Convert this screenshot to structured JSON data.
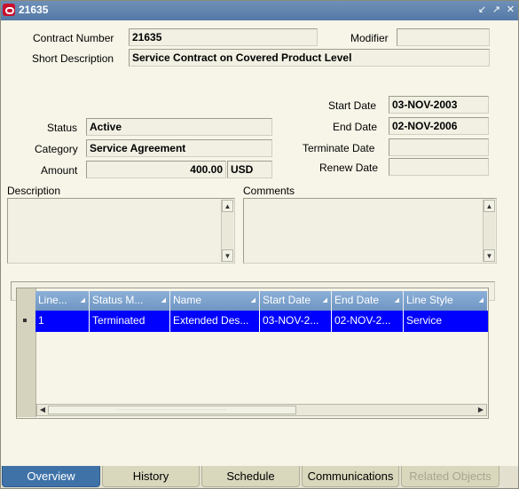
{
  "window": {
    "title": "21635"
  },
  "header": {
    "contract_number_label": "Contract Number",
    "contract_number": "21635",
    "modifier_label": "Modifier",
    "modifier": "",
    "short_description_label": "Short Description",
    "short_description": "Service Contract on Covered Product Level",
    "status_label": "Status",
    "status": "Active",
    "category_label": "Category",
    "category": "Service Agreement",
    "amount_label": "Amount",
    "amount": "400.00",
    "currency": "USD",
    "start_date_label": "Start Date",
    "start_date": "03-NOV-2003",
    "end_date_label": "End Date",
    "end_date": "02-NOV-2006",
    "terminate_date_label": "Terminate Date",
    "terminate_date": "",
    "renew_date_label": "Renew Date",
    "renew_date": "",
    "description_label": "Description",
    "description": "",
    "comments_label": "Comments",
    "comments": ""
  },
  "lines": {
    "columns": [
      "Line...",
      "Status M...",
      "Name",
      "Start Date",
      "End Date",
      "Line Style"
    ],
    "rows": [
      [
        "1",
        "Terminated",
        "Extended Des...",
        "03-NOV-2...",
        "02-NOV-2...",
        "Service"
      ]
    ]
  },
  "tabs": [
    {
      "label": "Overview",
      "state": "active"
    },
    {
      "label": "History",
      "state": "normal"
    },
    {
      "label": "Schedule",
      "state": "normal"
    },
    {
      "label": "Communications",
      "state": "normal"
    },
    {
      "label": "Related Objects",
      "state": "disabled"
    }
  ],
  "colors": {
    "title_bar": "#5479a6",
    "selected_row": "#0000ff",
    "column_header": "#7a9ecb",
    "active_tab": "#3f73a8"
  }
}
